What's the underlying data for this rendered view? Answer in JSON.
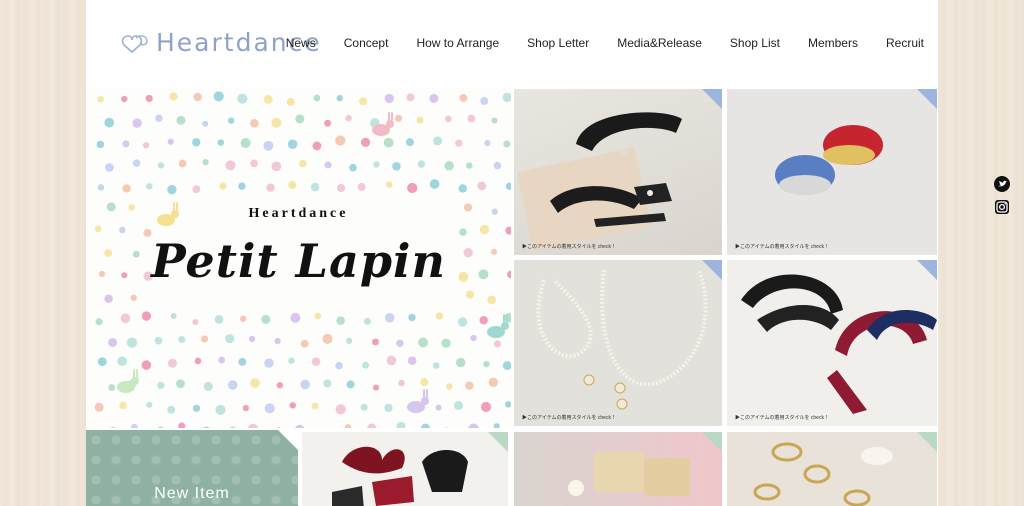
{
  "brand": {
    "logo_text": "Heartdance"
  },
  "nav": [
    {
      "label": "News"
    },
    {
      "label": "Concept"
    },
    {
      "label": "How to Arrange"
    },
    {
      "label": "Shop Letter"
    },
    {
      "label": "Media&Release"
    },
    {
      "label": "Shop List"
    },
    {
      "label": "Members"
    },
    {
      "label": "Recruit"
    }
  ],
  "hero": {
    "brand": "Heartdance",
    "title": "Petit Lapin"
  },
  "tiles": [
    {
      "caption": "▶このアイテムの着用スタイルを check ！"
    },
    {
      "caption": "▶このアイテムの着用スタイルを check ！"
    },
    {
      "caption": "▶このアイテムの着用スタイルを check ！"
    },
    {
      "caption": "▶このアイテムの着用スタイルを check ！"
    }
  ],
  "new_item": {
    "label": "New Item"
  },
  "social": {
    "twitter": "twitter-icon",
    "instagram": "instagram-icon"
  }
}
